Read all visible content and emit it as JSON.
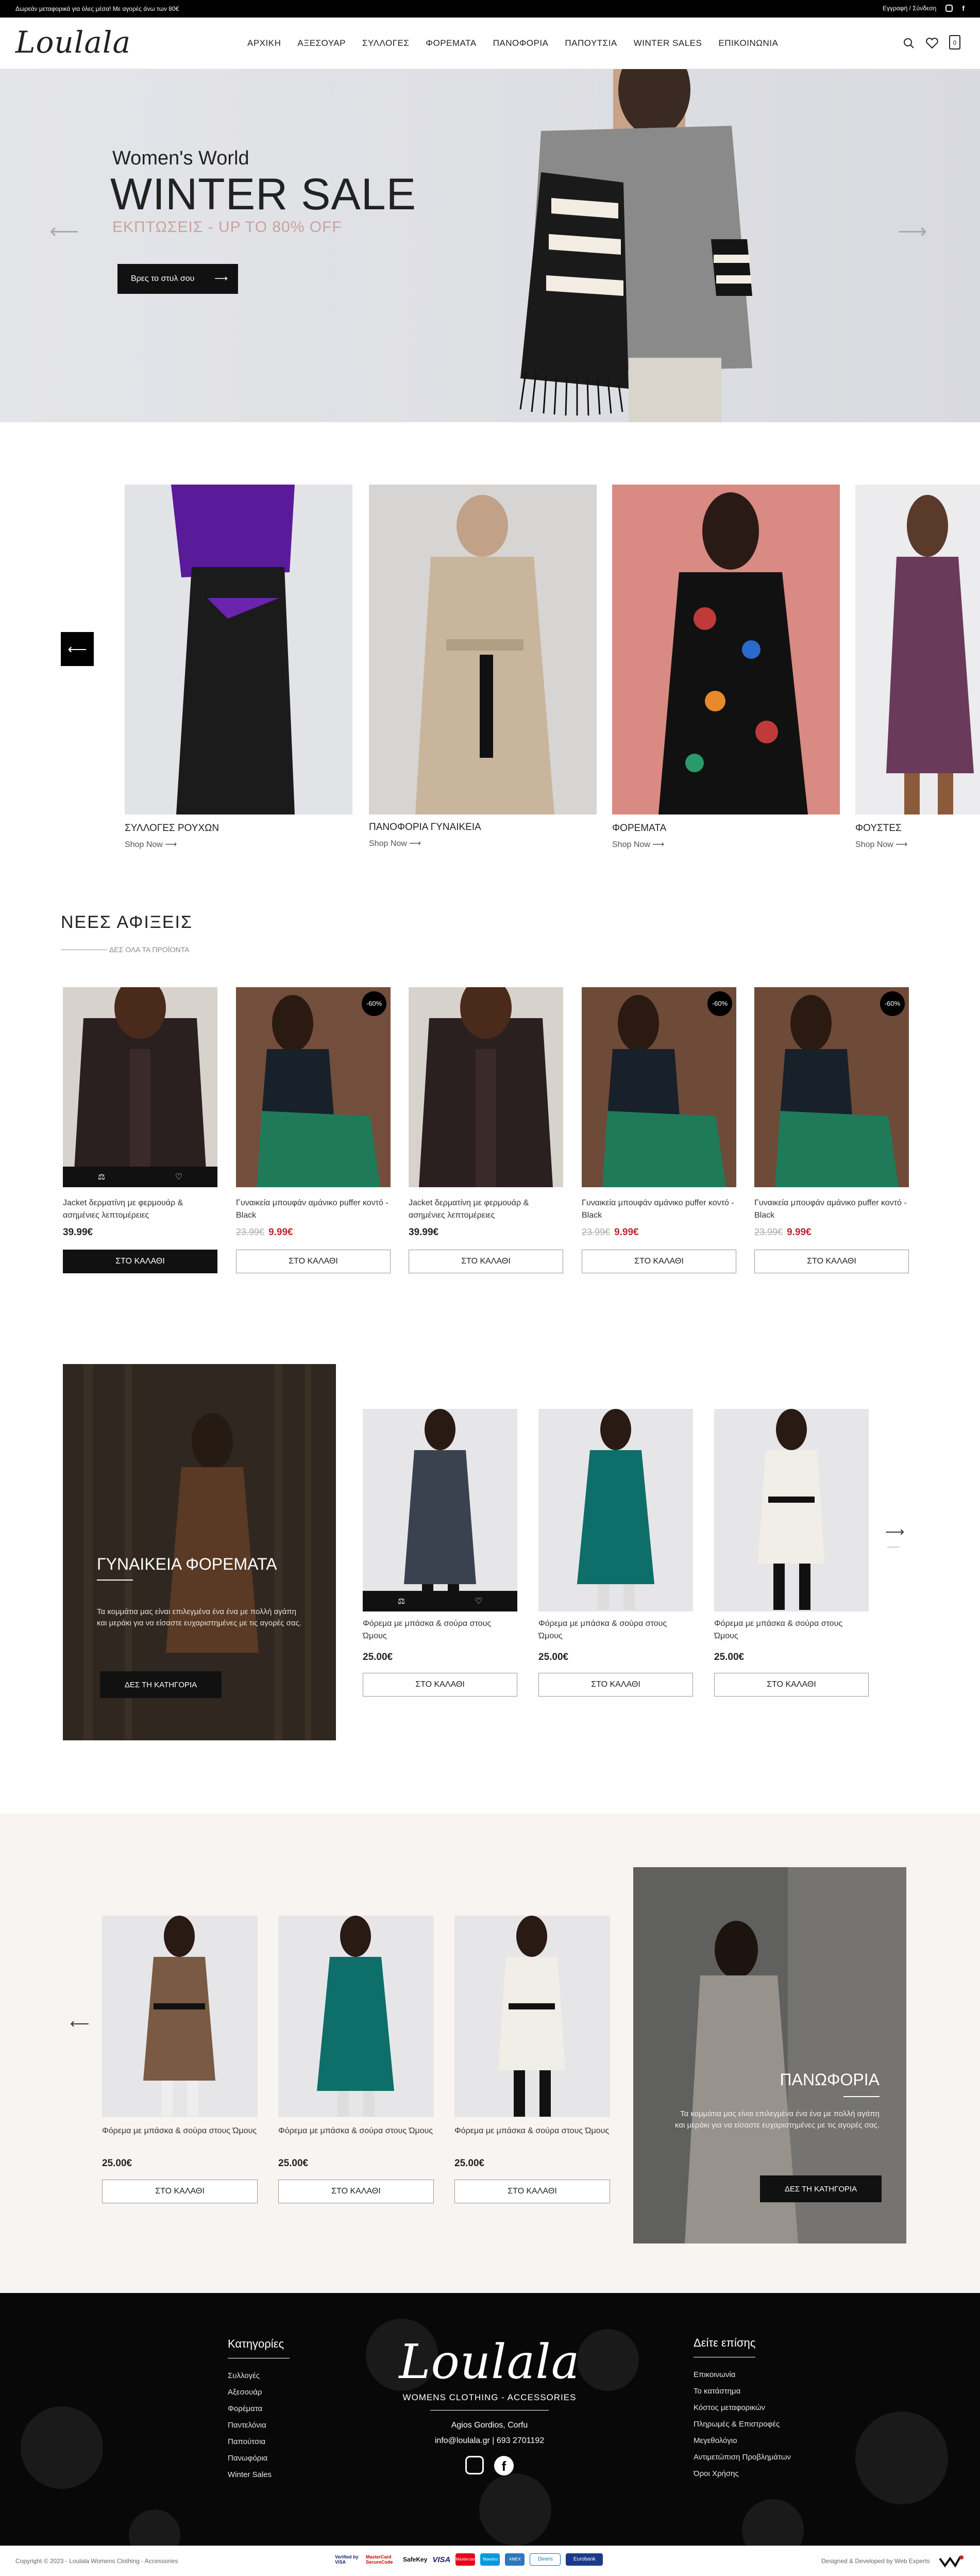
{
  "topbar": {
    "promo": "Δωρεάν μεταφορικά για όλες μέσα! Με αγορές άνω των 80€",
    "account": "Εγγραφή / Σύνδεση"
  },
  "header": {
    "logo": "Loulala",
    "nav": [
      "ΑΡΧΙΚΗ",
      "ΑΞΕΣΟΥΑΡ",
      "ΣΥΛΛΟΓΕΣ",
      "ΦΟΡΕΜΑΤΑ",
      "ΠΑΝΟΦΟΡΙΑ",
      "ΠΑΠΟΥΤΣΙΑ",
      "WINTER SALES",
      "ΕΠΙΚΟΙΝΩΝΙΑ"
    ],
    "cart_count": "0"
  },
  "hero": {
    "kicker": "Women's World",
    "title": "WINTER SALE",
    "subtitle": "ΕΚΠΤΩΣΕΙΣ - UP TO 80% OFF",
    "cta": "Βρες το στυλ σου"
  },
  "categories": [
    {
      "label": "ΣΥΛΛΟΓΕΣ ΡΟΥΧΩΝ",
      "link": "Shop Now"
    },
    {
      "label": "ΠΑΝΟΦΟΡΙΑ ΓΥΝΑΙΚΕΙΑ",
      "link": "Shop Now"
    },
    {
      "label": "ΦΟΡΕΜΑΤΑ",
      "link": "Shop Now"
    },
    {
      "label": "ΦΟΥΣΤΕΣ",
      "link": "Shop Now"
    }
  ],
  "arrivals": {
    "title": "ΝΕΕΣ ΑΦΙΞΕΙΣ",
    "see_all": "ΔΕΣ ΟΛΑ ΤΑ ΠΡΟΪΟΝΤΑ",
    "cart_label": "ΣΤΟ ΚΑΛΑΘΙ",
    "products": [
      {
        "name": "Jacket δερματίνη με φερμουάρ & ασημένιες λεπτομέρειες",
        "price": "39.99€",
        "old": "",
        "badge": ""
      },
      {
        "name": "Γυναικεία μπουφάν αμάνικο puffer κοντό - Black",
        "price": "9.99€",
        "old": "23.99€",
        "badge": "-60%"
      },
      {
        "name": "Jacket δερματίνη με φερμουάρ & ασημένιες λεπτομέρειες",
        "price": "39.99€",
        "old": "",
        "badge": ""
      },
      {
        "name": "Γυναικεία μπουφάν αμάνικο puffer κοντό - Black",
        "price": "9.99€",
        "old": "23.99€",
        "badge": "-60%"
      },
      {
        "name": "Γυναικεία μπουφάν αμάνικο puffer κοντό - Black",
        "price": "9.99€",
        "old": "23.99€",
        "badge": "-60%"
      }
    ]
  },
  "dresses": {
    "title": "ΓΥΝΑΙΚΕΙΑ ΦΟΡΕΜΑΤΑ",
    "text": "Τα κομμάτια μας είναι επιλεγμένα ένα ένα με πολλή αγάπη και μεράκι για να είσαστε ευχαριστημένες με τις αγορές σας.",
    "cta": "ΔΕΣ ΤΗ ΚΑΤΗΓΟΡΙΑ",
    "products": [
      {
        "name": "Φόρεμα με μπάσκα & σούρα στους Ώμους",
        "price": "25.00€"
      },
      {
        "name": "Φόρεμα με μπάσκα & σούρα στους Ώμους",
        "price": "25.00€"
      },
      {
        "name": "Φόρεμα με μπάσκα & σούρα στους Ώμους",
        "price": "25.00€"
      }
    ]
  },
  "coats": {
    "title": "ΠΑΝΩΦΟΡΙΑ",
    "text": "Τα κομμάτια μας είναι επιλεγμένα ένα ένα με πολλή αγάπη και μεράκι για να είσαστε ευχαριστημένες με τις αγορές σας.",
    "cta": "ΔΕΣ ΤΗ ΚΑΤΗΓΟΡΙΑ",
    "products": [
      {
        "name": "Φόρεμα με μπάσκα & σούρα στους Ώμους",
        "price": "25.00€"
      },
      {
        "name": "Φόρεμα με μπάσκα & σούρα στους Ώμους",
        "price": "25.00€"
      },
      {
        "name": "Φόρεμα με μπάσκα & σούρα στους Ώμους",
        "price": "25.00€"
      }
    ]
  },
  "footer": {
    "cat_title": "Κατηγορίες",
    "cats": [
      "Συλλογές",
      "Αξεσουάρ",
      "Φορέματα",
      "Παντελόνια",
      "Παπούτσια",
      "Πανωφόρια",
      "Winter Sales"
    ],
    "logo": "Loulala",
    "tagline": "WOMENS CLOTHING - ACCESSORIES",
    "address": "Agios Gordios, Corfu",
    "contact": "info@loulala.gr  |  693 2701192",
    "see_title": "Δείτε επίσης",
    "see": [
      "Επικοινωνία",
      "Το κατάστημα",
      "Κόστος μεταφορικών",
      "Πληρωμές & Επιστροφές",
      "Μεγεθολόγιο",
      "Αντιμετώπιση Προβλημάτων",
      "Όροι Χρήσης"
    ],
    "copyright": "Copyright © 2023 - Loulala Womens Clothing - Accessories",
    "payments": [
      "Verified by VISA",
      "MasterCard SecureCode",
      "SafeKey",
      "VISA",
      "Mastercard",
      "Maestro",
      "AMEX",
      "Diners",
      "Eurobank"
    ],
    "credit": "Designed & Developed by Web Experts"
  },
  "colors": {
    "accent": "#c0272d",
    "dark": "#111111",
    "hero_sub": "#c9a39a"
  }
}
